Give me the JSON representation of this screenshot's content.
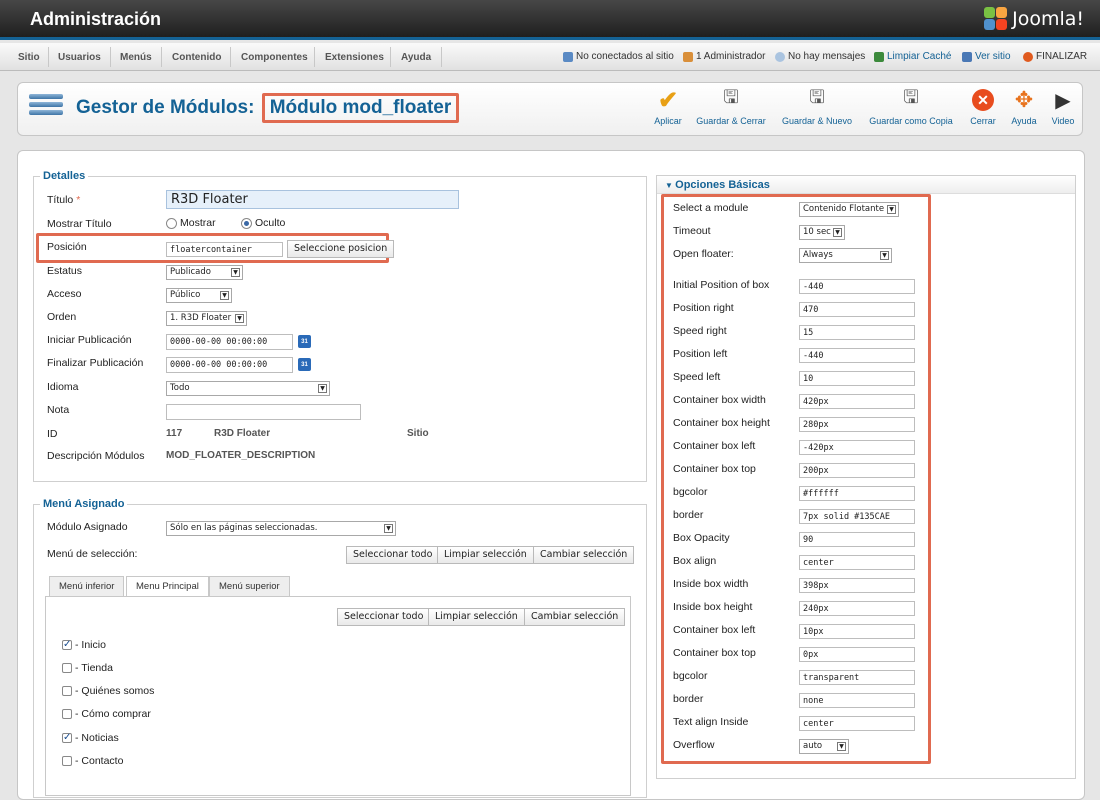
{
  "app": {
    "title": "Administración",
    "logo_text": "Joomla!"
  },
  "menu": [
    "Sitio",
    "Usuarios",
    "Menús",
    "Contenido",
    "Componentes",
    "Extensiones",
    "Ayuda"
  ],
  "status": {
    "not_connected": "No conectados al sitio",
    "admins": "1 Administrador",
    "messages": "No hay mensajes",
    "clear_cache": "Limpiar Caché",
    "view_site": "Ver sitio",
    "logout": "FINALIZAR"
  },
  "page": {
    "title_prefix": "Gestor de Módulos:",
    "title_module": "Módulo mod_floater"
  },
  "toolbar": {
    "apply": "Aplicar",
    "save_close": "Guardar & Cerrar",
    "save_new": "Guardar & Nuevo",
    "save_copy": "Guardar como Copia",
    "close": "Cerrar",
    "help": "Ayuda",
    "video": "Video"
  },
  "details": {
    "legend": "Detalles",
    "title_label": "Título",
    "title_value": "R3D Floater",
    "show_title_label": "Mostrar Título",
    "show_opt": "Mostrar",
    "hide_opt": "Oculto",
    "position_label": "Posición",
    "position_value": "floatercontainer",
    "position_btn": "Seleccione posicion",
    "status_label": "Estatus",
    "status_value": "Publicado",
    "access_label": "Acceso",
    "access_value": "Público",
    "order_label": "Orden",
    "order_value": "1. R3D Floater",
    "start_label": "Iniciar Publicación",
    "start_value": "0000-00-00 00:00:00",
    "end_label": "Finalizar Publicación",
    "end_value": "0000-00-00 00:00:00",
    "lang_label": "Idioma",
    "lang_value": "Todo",
    "note_label": "Nota",
    "note_value": "",
    "id_label": "ID",
    "id_value": "117",
    "id_name": "R3D Floater",
    "id_site": "Sitio",
    "desc_label": "Descripción Módulos",
    "desc_value": "MOD_FLOATER_DESCRIPTION"
  },
  "menu_assign": {
    "legend": "Menú Asignado",
    "assigned_label": "Módulo Asignado",
    "assigned_value": "Sólo en las páginas seleccionadas.",
    "selection_label": "Menú de selección:",
    "select_all": "Seleccionar todo",
    "clear_sel": "Limpiar selección",
    "toggle_sel": "Cambiar selección",
    "tabs": [
      "Menú inferior",
      "Menu Principal",
      "Menú superior"
    ],
    "items": [
      {
        "label": "- Inicio",
        "checked": true
      },
      {
        "label": "- Tienda",
        "checked": false
      },
      {
        "label": "- Quiénes somos",
        "checked": false
      },
      {
        "label": "- Cómo comprar",
        "checked": false
      },
      {
        "label": "- Noticias",
        "checked": true
      },
      {
        "label": "- Contacto",
        "checked": false
      }
    ]
  },
  "options": {
    "header": "Opciones Básicas",
    "fields": [
      {
        "label": "Select a module",
        "value": "Contenido Flotante",
        "type": "select"
      },
      {
        "label": "Timeout",
        "value": "10 sec",
        "type": "select"
      },
      {
        "label": "Open floater:",
        "value": "Always",
        "type": "select"
      },
      {
        "label": "Initial Position of box",
        "value": "-440",
        "type": "text"
      },
      {
        "label": "Position right",
        "value": "470",
        "type": "text"
      },
      {
        "label": "Speed right",
        "value": "15",
        "type": "text"
      },
      {
        "label": "Position left",
        "value": "-440",
        "type": "text"
      },
      {
        "label": "Speed left",
        "value": "10",
        "type": "text"
      },
      {
        "label": "Container box width",
        "value": "420px",
        "type": "text"
      },
      {
        "label": "Container box height",
        "value": "280px",
        "type": "text"
      },
      {
        "label": "Container box left",
        "value": "-420px",
        "type": "text"
      },
      {
        "label": "Container box top",
        "value": "200px",
        "type": "text"
      },
      {
        "label": "bgcolor",
        "value": "#ffffff",
        "type": "text"
      },
      {
        "label": "border",
        "value": "7px solid #135CAE",
        "type": "text"
      },
      {
        "label": "Box Opacity",
        "value": "90",
        "type": "text"
      },
      {
        "label": "Box align",
        "value": "center",
        "type": "text"
      },
      {
        "label": "Inside box width",
        "value": "398px",
        "type": "text"
      },
      {
        "label": "Inside box height",
        "value": "240px",
        "type": "text"
      },
      {
        "label": "Container box left",
        "value": "10px",
        "type": "text"
      },
      {
        "label": "Container box top",
        "value": "0px",
        "type": "text"
      },
      {
        "label": "bgcolor",
        "value": "transparent",
        "type": "text"
      },
      {
        "label": "border",
        "value": "none",
        "type": "text"
      },
      {
        "label": "Text align Inside",
        "value": "center",
        "type": "text"
      },
      {
        "label": "Overflow",
        "value": "auto",
        "type": "select"
      }
    ]
  },
  "colors": {
    "accent": "#146295",
    "highlight": "#e06a50"
  }
}
